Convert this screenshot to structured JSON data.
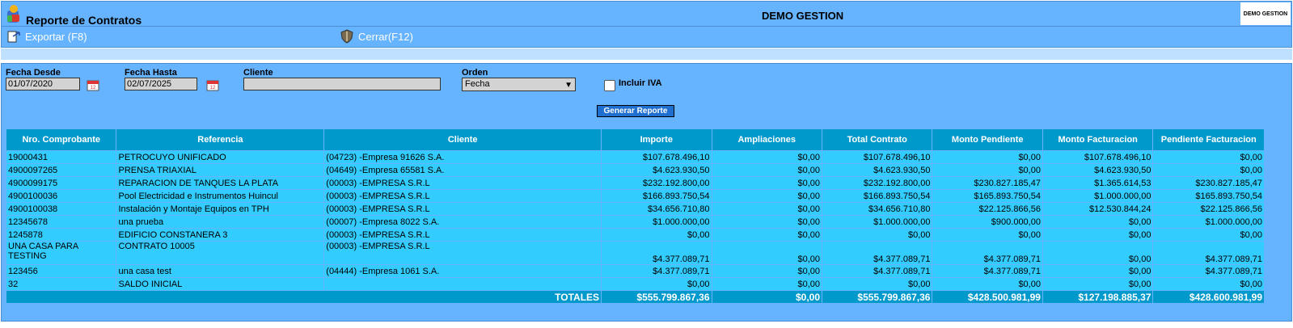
{
  "header": {
    "title": "Reporte de Contratos",
    "company": "DEMO GESTION",
    "brand_text": "DEMO GESTION"
  },
  "toolbar": {
    "export_label": "Exportar (F8)",
    "close_label": "Cerrar(F12)"
  },
  "filters": {
    "fecha_desde_label": "Fecha Desde",
    "fecha_desde_value": "01/07/2020",
    "fecha_hasta_label": "Fecha Hasta",
    "fecha_hasta_value": "02/07/2025",
    "cliente_label": "Cliente",
    "cliente_value": "",
    "orden_label": "Orden",
    "orden_value": "Fecha",
    "iva_label": "Incluir IVA",
    "iva_checked": false,
    "generate_label": "Generar Reporte"
  },
  "table": {
    "headers": [
      "Nro. Comprobante",
      "Referencia",
      "Cliente",
      "Importe",
      "Ampliaciones",
      "Total Contrato",
      "Monto Pendiente",
      "Monto Facturacion",
      "Pendiente Facturacion"
    ],
    "rows": [
      [
        "19000431",
        "PETROCUYO UNIFICADO",
        "(04723) -Empresa 91626 S.A.",
        "$107.678.496,10",
        "$0,00",
        "$107.678.496,10",
        "$0,00",
        "$107.678.496,10",
        "$0,00"
      ],
      [
        "4900097265",
        "PRENSA TRIAXIAL",
        "(04649) -Empresa 65581 S.A.",
        "$4.623.930,50",
        "$0,00",
        "$4.623.930,50",
        "$0,00",
        "$4.623.930,50",
        "$0,00"
      ],
      [
        "4900099175",
        "REPARACION DE TANQUES LA PLATA",
        "(00003) -EMPRESA S.R.L",
        "$232.192.800,00",
        "$0,00",
        "$232.192.800,00",
        "$230.827.185,47",
        "$1.365.614,53",
        "$230.827.185,47"
      ],
      [
        "4900100036",
        "Pool Electricidad e Instrumentos Huincul",
        "(00003) -EMPRESA S.R.L",
        "$166.893.750,54",
        "$0,00",
        "$166.893.750,54",
        "$165.893.750,54",
        "$1.000.000,00",
        "$165.893.750,54"
      ],
      [
        "4900100038",
        "Instalación y Montaje Equipos en TPH",
        "(00003) -EMPRESA S.R.L",
        "$34.656.710,80",
        "$0,00",
        "$34.656.710,80",
        "$22.125.866,56",
        "$12.530.844,24",
        "$22.125.866,56"
      ],
      [
        "12345678",
        "una prueba",
        "(00007) -Empresa 8022 S.A.",
        "$1.000.000,00",
        "$0,00",
        "$1.000.000,00",
        "$900.000,00",
        "$0,00",
        "$1.000.000,00"
      ],
      [
        "1245878",
        "EDIFICIO CONSTANERA 3",
        "(00003) -EMPRESA S.R.L",
        "$0,00",
        "$0,00",
        "$0,00",
        "$0,00",
        "$0,00",
        "$0,00"
      ],
      [
        "UNA CASA PARA TESTING",
        "CONTRATO 10005",
        "(00003) -EMPRESA S.R.L",
        "$4.377.089,71",
        "$0,00",
        "$4.377.089,71",
        "$4.377.089,71",
        "$0,00",
        "$4.377.089,71"
      ],
      [
        "123456",
        "una casa test",
        "(04444) -Empresa 1061 S.A.",
        "$4.377.089,71",
        "$0,00",
        "$4.377.089,71",
        "$4.377.089,71",
        "$0,00",
        "$4.377.089,71"
      ],
      [
        "32",
        "SALDO INICIAL",
        "",
        "$0,00",
        "$0,00",
        "$0,00",
        "$0,00",
        "$0,00",
        "$0,00"
      ]
    ],
    "totals_label": "TOTALES",
    "totals": [
      "$555.799.867,36",
      "$0,00",
      "$555.799.867,36",
      "$428.500.981,99",
      "$127.198.885,37",
      "$428.600.981,99"
    ]
  },
  "colors": {
    "header_blue": "#66b3ff",
    "table_header": "#0099cc",
    "table_cell": "#33ccff"
  },
  "icons": {
    "logo": "app-logo-icon",
    "export": "export-icon",
    "close": "close-shield-icon",
    "calendar": "calendar-icon"
  }
}
